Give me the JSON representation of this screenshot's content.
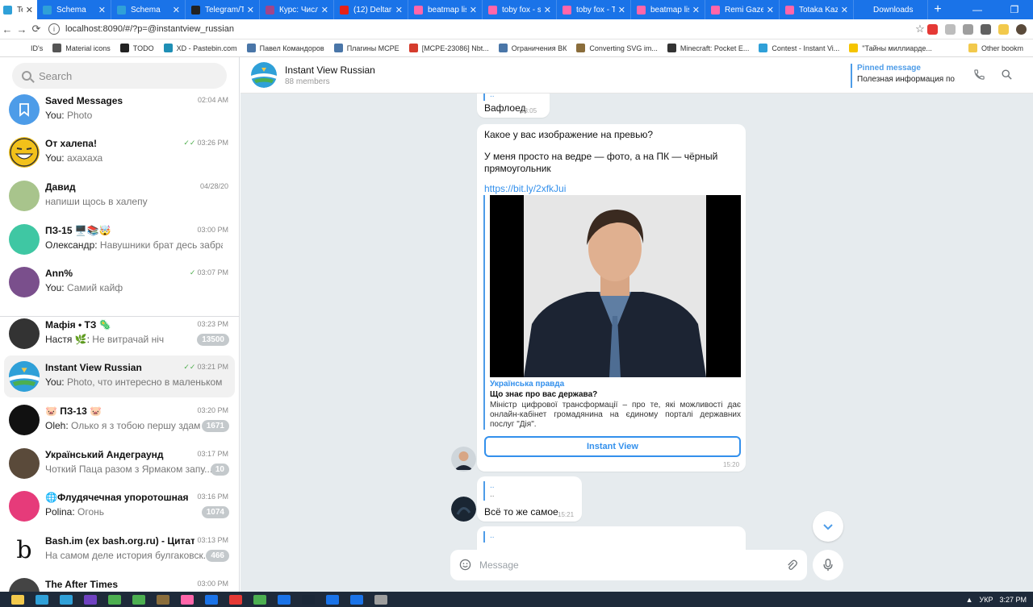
{
  "browser": {
    "tabs": [
      {
        "label": "Telegr",
        "active": true,
        "color": "#2fa0d8"
      },
      {
        "label": "Schema",
        "color": "#2fa0d8"
      },
      {
        "label": "Schema",
        "color": "#2fa0d8"
      },
      {
        "label": "Telegram/TI",
        "color": "#222222"
      },
      {
        "label": "Курс: Числе",
        "color": "#a0458b"
      },
      {
        "label": "(12) Deltaru",
        "color": "#e62117"
      },
      {
        "label": "beatmap list",
        "color": "#ff66aa"
      },
      {
        "label": "toby fox - sa",
        "color": "#ff66aa"
      },
      {
        "label": "toby fox - To",
        "color": "#ff66aa"
      },
      {
        "label": "beatmap list",
        "color": "#ff66aa"
      },
      {
        "label": "Remi Gazel",
        "color": "#ff66aa"
      },
      {
        "label": "Totaka Kazu",
        "color": "#ff66aa"
      },
      {
        "label": "Downloads",
        "color": "#1a73e8"
      }
    ],
    "new_tab": "+",
    "url": "localhost:8090/#/?p=@instantview_russian",
    "bookmarks": [
      {
        "label": "ID's",
        "color": "#ffffff"
      },
      {
        "label": "Material icons",
        "color": "#555555"
      },
      {
        "label": "TODO",
        "color": "#222222"
      },
      {
        "label": "XD - Pastebin.com",
        "color": "#1f8fb5"
      },
      {
        "label": "Павел Командоров",
        "color": "#4a76a8"
      },
      {
        "label": "Плагины MCPE",
        "color": "#4a76a8"
      },
      {
        "label": "[MCPE-23086] Nbt...",
        "color": "#d53c2d"
      },
      {
        "label": "Ограничения ВК",
        "color": "#4a76a8"
      },
      {
        "label": "Converting SVG im...",
        "color": "#8a6d3b"
      },
      {
        "label": "Minecraft: Pocket E...",
        "color": "#333333"
      },
      {
        "label": "Contest - Instant Vi...",
        "color": "#2fa0d8"
      },
      {
        "label": "\"Тайны миллиарде...",
        "color": "#f5c400"
      }
    ],
    "other_bookmarks": "Other bookm"
  },
  "sidebar": {
    "search_placeholder": "Search",
    "chats": [
      {
        "name": "Saved Messages",
        "time": "02:04 AM",
        "sender": "You:",
        "preview": "Photo",
        "avatar_color": "#4d9ce8",
        "avatar_icon": "bookmark-icon"
      },
      {
        "name": "От халепа!",
        "time": "03:26 PM",
        "sender": "You:",
        "preview": "ахахаха",
        "check": "✓✓",
        "avatar_color": "#f2c11a",
        "avatar_icon": "laughing-face-icon"
      },
      {
        "name": "Давид",
        "time": "04/28/20",
        "sender": "",
        "preview": "напиши щось в халепу",
        "avatar_color": "#a8c48c",
        "avatar_icon": "photo-avatar"
      },
      {
        "name": "ПЗ-15 🖥️📚🤯",
        "time": "03:00 PM",
        "sender": "Олександр:",
        "preview": "Навушники брат десь забра...",
        "avatar_color": "#3fc7a3",
        "avatar_icon": "group-avatar"
      },
      {
        "name": "Ann%",
        "time": "03:07 PM",
        "sender": "You:",
        "preview": "Самий кайф",
        "check": "✓",
        "avatar_color": "#7a4f8c",
        "avatar_icon": "anime-avatar"
      },
      {
        "name": "Мафія • ТЗ 🦠",
        "time": "03:23 PM",
        "sender": "Настя 🌿:",
        "preview": "Не витрачай ніч",
        "badge": "13500",
        "avatar_color": "#333333",
        "avatar_icon": "mafia-avatar"
      },
      {
        "name": "Instant View Russian",
        "time": "03:21 PM",
        "sender": "You:",
        "preview": "Photo, что интересно в маленьком п...",
        "check": "✓✓",
        "selected": true,
        "avatar_color": "#2fa0d8",
        "avatar_icon": "instant-view-avatar"
      },
      {
        "name": "🐷 ПЗ-13 🐷",
        "time": "03:20 PM",
        "sender": "Oleh:",
        "preview": "Олько я з тобою першу здам",
        "badge": "1671",
        "avatar_color": "#111111",
        "avatar_icon": "group-avatar"
      },
      {
        "name": "Український Андеграунд",
        "time": "03:17 PM",
        "sender": "",
        "preview": "Чоткий Паца разом з Ярмаком запу...",
        "badge": "10",
        "avatar_color": "#5a4a3a",
        "avatar_icon": "channel-avatar"
      },
      {
        "name": "🌐Флудячечная упоротошная",
        "time": "03:16 PM",
        "sender": "Polina:",
        "preview": "Огонь",
        "badge": "1074",
        "avatar_color": "#e63b7a",
        "avatar_icon": "rainbow-avatar"
      },
      {
        "name": "Bash.im (ex bash.org.ru) - Цитатни...",
        "time": "03:13 PM",
        "sender": "",
        "preview": "На самом деле история булгаковск...",
        "badge": "466",
        "avatar_color": "#ffffff",
        "avatar_icon": "b-letter-avatar",
        "avatar_letter": "b"
      },
      {
        "name": "The After Times",
        "time": "03:00 PM",
        "sender": "",
        "preview": "",
        "avatar_color": "#444444",
        "avatar_icon": "channel-avatar"
      }
    ]
  },
  "header": {
    "title": "Instant View Russian",
    "subtitle": "88 members",
    "pinned_label": "Pinned message",
    "pinned_text": "Полезная информация по..."
  },
  "messages": {
    "m1": {
      "reply": "..",
      "text": "Вафлоед",
      "time": "18:05"
    },
    "m2": {
      "line1": "Какое у вас изображение на превью?",
      "line2": "У меня просто на ведре — фото, а на ПК — чёрный прямоугольник",
      "link": "https://bit.ly/2xfkJui",
      "site": "Українська правда",
      "article_title": "Що знає про вас держава?",
      "article_desc": "Міністр цифрової трансформації – про те, які можливості дає онлайн-кабінет громадянина на єдиному порталі державних послуг \"Дія\".",
      "button": "Instant View",
      "time": "15:20"
    },
    "m3": {
      "reply1": "..",
      "reply2": "..",
      "text": "Всё то же самое",
      "time": "15:21"
    },
    "m4": {
      "reply": ".."
    }
  },
  "composer": {
    "placeholder": "Message"
  },
  "taskbar": {
    "lang": "УКР",
    "time": "3:27 PM",
    "icons": [
      "#f2c94c",
      "#2fa0d8",
      "#2fa0d8",
      "#6f42c1",
      "#4caf50",
      "#4caf50",
      "#8a6d3b",
      "#ff66aa",
      "#1a73e8",
      "#e53935",
      "#4caf50",
      "#1a73e8",
      "#1b2838",
      "#1a73e8",
      "#1a73e8",
      "#9e9e9e"
    ]
  }
}
